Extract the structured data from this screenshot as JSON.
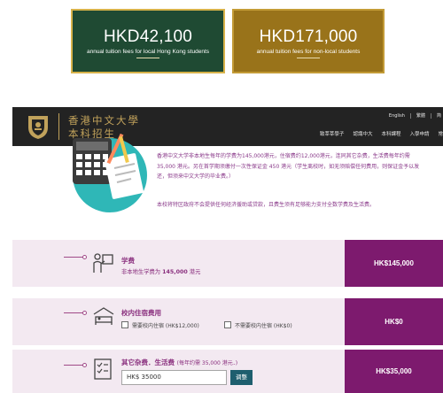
{
  "fee_cards": {
    "local": {
      "amount": "HKD42,100",
      "caption": "annual tuition fees for local Hong Kong students"
    },
    "nonlocal": {
      "amount": "HKD171,000",
      "caption": "annual tuition fees for non-local students"
    }
  },
  "header": {
    "brand_cn": "香港中文大學",
    "brand_sub": "本科招生",
    "lang": [
      "English",
      "繁體",
      "简"
    ],
    "nav": [
      "致莘莘學子",
      "認識中大",
      "本科課程",
      "入學申請",
      "常"
    ]
  },
  "intro": {
    "paragraph": "香港中文大学非本地生每年的学费为145,000港元，住宿费约12,000港元，连同其它杂费，生活费每年约需 35,000 港元。另在首学期须缴付一次性保证金 450 港元（学生离校时，如无须赔偿任何费用，则保证金予以发还，但须来中文大学的毕业费。）",
    "note": "本校将特区政府不会提供任何经济援助或贷款，且费生须有足够能力支付全数学费及生活费。"
  },
  "rows": {
    "tuition": {
      "title": "学费",
      "sub_prefix": "非本地生学费为",
      "sub_value": "145,000",
      "sub_suffix": "港元",
      "amount": "HK$145,000"
    },
    "housing": {
      "title": "校内住宿费用",
      "opt_yes": "需要校内住宿 (HK$12,000)",
      "opt_no": "不需要校内住宿 (HK$0)",
      "amount": "HK$0"
    },
    "other": {
      "title": "其它杂费．生活费",
      "title_note": "(每年约需 35,000 港元．)",
      "input_prefix": "HK$",
      "input_value": "35000",
      "button": "调整",
      "amount": "HK$35,000"
    }
  },
  "colors": {
    "local_card": "#1f4a33",
    "nonlocal_card": "#99731a",
    "header": "#232323",
    "accent": "#7d1a6e",
    "row_band": "#f3e9f1"
  }
}
